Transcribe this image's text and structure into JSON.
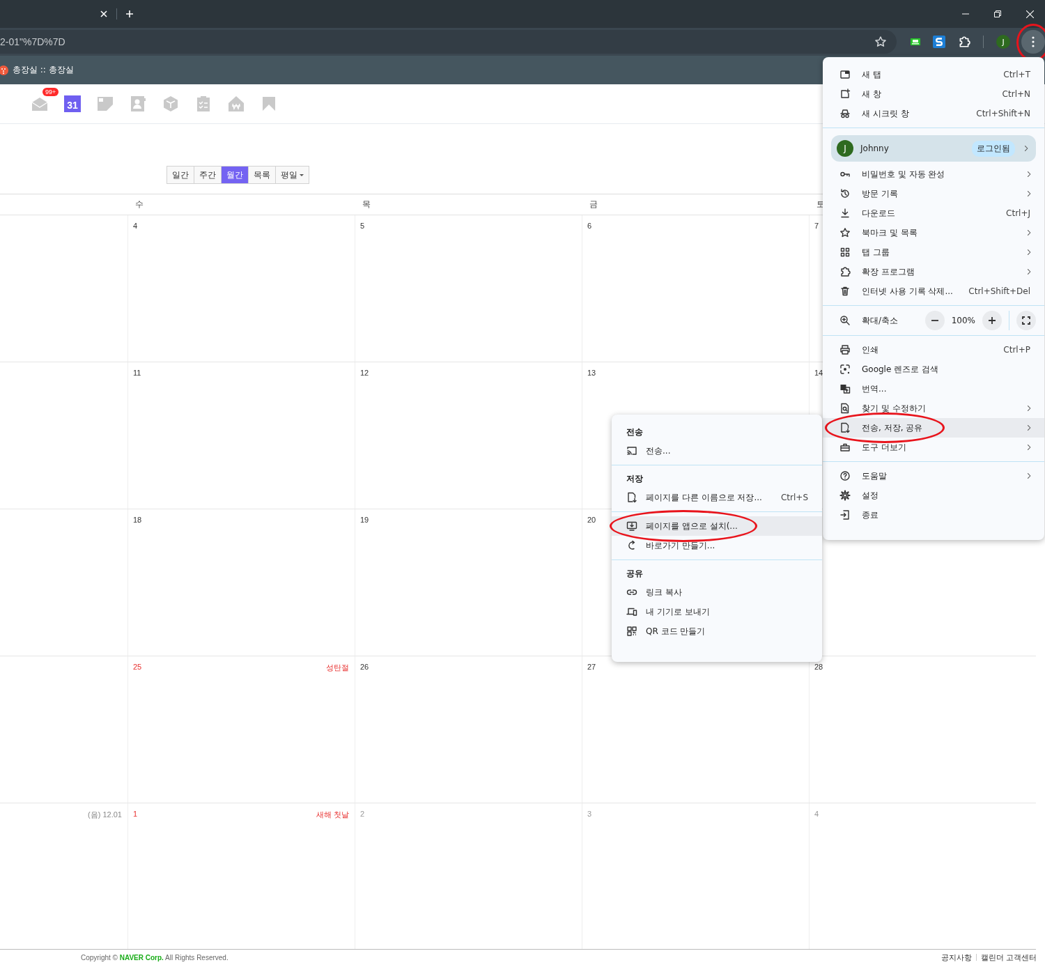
{
  "browser": {
    "address": "2-01\"%7D%7D",
    "profile_initial": "J",
    "menu_button": {
      "circled": true
    }
  },
  "bookmarks": [
    {
      "label": "총장실 :: 총장실"
    }
  ],
  "apps": [
    {
      "kind": "mail",
      "badge": "99+"
    },
    {
      "kind": "calendar",
      "label": "31"
    },
    {
      "kind": "note"
    },
    {
      "kind": "contacts"
    },
    {
      "kind": "box"
    },
    {
      "kind": "todo"
    },
    {
      "kind": "household"
    },
    {
      "kind": "bookmark"
    }
  ],
  "view_buttons": [
    {
      "label": "일간",
      "selected": false
    },
    {
      "label": "주간",
      "selected": false
    },
    {
      "label": "월간",
      "selected": true
    },
    {
      "label": "목록",
      "selected": false
    },
    {
      "label": "평일",
      "selected": false,
      "kind": "dropdown"
    }
  ],
  "weekday_headers": [
    "수",
    "목",
    "금",
    "토"
  ],
  "weeks": [
    {
      "cells": [
        {},
        {
          "date": "4",
          "kind": "day"
        },
        {
          "date": "5",
          "kind": "day"
        },
        {
          "date": "6",
          "kind": "day"
        },
        {
          "date": "7",
          "kind": "day"
        }
      ]
    },
    {
      "cells": [
        {},
        {
          "date": "11",
          "kind": "day"
        },
        {
          "date": "12",
          "kind": "day"
        },
        {
          "date": "13",
          "kind": "day"
        },
        {
          "date": "14",
          "kind": "day"
        }
      ]
    },
    {
      "cells": [
        {},
        {
          "date": "18",
          "kind": "day"
        },
        {
          "date": "19",
          "kind": "day"
        },
        {
          "date": "20",
          "kind": "day"
        },
        {}
      ]
    },
    {
      "cells": [
        {},
        {
          "date": "25",
          "kind": "holiday",
          "holiday": "성탄절"
        },
        {
          "date": "26",
          "kind": "day"
        },
        {
          "date": "27",
          "kind": "day"
        },
        {
          "date": "28",
          "kind": "day"
        }
      ]
    },
    {
      "cells": [
        {
          "lunar": "(음) 12.01"
        },
        {
          "date": "1",
          "kind": "holiday",
          "holiday": "새해 첫날"
        },
        {
          "date": "2",
          "kind": "other_month"
        },
        {
          "date": "3",
          "kind": "other_month"
        },
        {
          "date": "4",
          "kind": "other_month"
        }
      ]
    }
  ],
  "footer": {
    "copyright": "Copyright © **NAVER Corp.** All Rights Reserved.",
    "links": [
      "공지사항",
      "캘린더 고객센터"
    ]
  },
  "menu": {
    "sections": [
      {
        "items": [
          {
            "kind": "item",
            "label": "새 탭",
            "shortcut": "Ctrl+T"
          },
          {
            "kind": "item",
            "label": "새 창",
            "shortcut": "Ctrl+N"
          },
          {
            "kind": "item",
            "label": "새 시크릿 창",
            "shortcut": "Ctrl+Shift+N"
          }
        ]
      },
      {
        "items": [
          {
            "kind": "profile",
            "initial": "J",
            "label": "Johnny",
            "badge": "로그인됨",
            "submenu": true
          },
          {
            "kind": "item",
            "label": "비밀번호 및 자동 완성",
            "submenu": true
          },
          {
            "kind": "item",
            "label": "방문 기록",
            "submenu": true
          },
          {
            "kind": "item",
            "label": "다운로드",
            "shortcut": "Ctrl+J"
          },
          {
            "kind": "item",
            "label": "북마크 및 목록",
            "submenu": true
          },
          {
            "kind": "item",
            "label": "탭 그룹",
            "submenu": true
          },
          {
            "kind": "item",
            "label": "확장 프로그램",
            "submenu": true
          },
          {
            "kind": "item",
            "label": "인터넷 사용 기록 삭제...",
            "shortcut": "Ctrl+Shift+Del"
          }
        ]
      },
      {
        "items": [
          {
            "kind": "zoom",
            "label": "확대/축소",
            "value": "100%"
          }
        ]
      },
      {
        "items": [
          {
            "kind": "item",
            "label": "인쇄",
            "shortcut": "Ctrl+P"
          },
          {
            "kind": "item",
            "label": "Google 렌즈로 검색"
          },
          {
            "kind": "item",
            "label": "번역..."
          },
          {
            "kind": "item",
            "label": "찾기 및 수정하기",
            "submenu": true
          },
          {
            "kind": "item",
            "label": "전송, 저장, 공유",
            "submenu": true,
            "highlighted": true,
            "circled": true
          },
          {
            "kind": "item",
            "label": "도구 더보기",
            "submenu": true
          }
        ]
      },
      {
        "items": [
          {
            "kind": "item",
            "label": "도움말",
            "submenu": true
          },
          {
            "kind": "item",
            "label": "설정"
          },
          {
            "kind": "item",
            "label": "종료"
          }
        ]
      }
    ]
  },
  "submenu": {
    "sections": [
      {
        "heading": "전송",
        "items": [
          {
            "label": "전송..."
          }
        ]
      },
      {
        "heading": "저장",
        "items": [
          {
            "label": "페이지를 다른 이름으로 저장...",
            "shortcut": "Ctrl+S"
          }
        ]
      },
      {
        "items": [
          {
            "label": "페이지를 앱으로 설치(...",
            "highlighted": true,
            "circled": true
          },
          {
            "label": "바로가기 만들기..."
          }
        ]
      },
      {
        "heading": "공유",
        "items": [
          {
            "label": "링크 복사"
          },
          {
            "label": "내 기기로 보내기"
          },
          {
            "label": "QR 코드 만들기"
          }
        ]
      }
    ]
  }
}
